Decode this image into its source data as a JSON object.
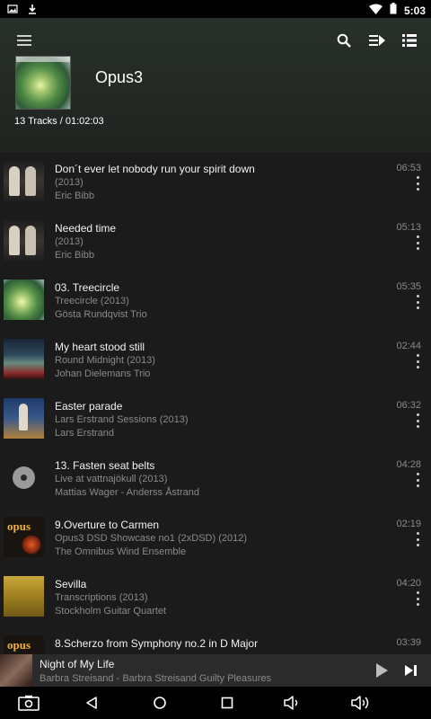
{
  "status": {
    "time": "5:03"
  },
  "header": {
    "title": "Opus3",
    "summary": "13 Tracks / 01:02:03"
  },
  "tracks": [
    {
      "title": "Don´t ever let nobody run your spirit down",
      "album": " (2013)",
      "artist": "Eric Bibb",
      "duration": "06:53",
      "art": "eric"
    },
    {
      "title": "Needed time",
      "album": " (2013)",
      "artist": "Eric Bibb",
      "duration": "05:13",
      "art": "eric"
    },
    {
      "title": "03. Treecircle",
      "album": "Treecircle (2013)",
      "artist": "Gösta Rundqvist Trio",
      "duration": "05:35",
      "art": "tree"
    },
    {
      "title": "My heart stood still",
      "album": "Round Midnight (2013)",
      "artist": "Johan Dielemans Trio",
      "duration": "02:44",
      "art": "midnight"
    },
    {
      "title": "Easter parade",
      "album": "Lars Erstrand Sessions (2013)",
      "artist": "Lars Erstrand",
      "duration": "06:32",
      "art": "easter"
    },
    {
      "title": "13. Fasten seat belts",
      "album": "Live at vattnajökull (2013)",
      "artist": "Mattias Wager - Anderss Åstrand",
      "duration": "04:28",
      "art": "disc"
    },
    {
      "title": "9.Overture to Carmen",
      "album": "Opus3 DSD Showcase no1 (2xDSD) (2012)",
      "artist": "The Omnibus Wind Ensemble",
      "duration": "02:19",
      "art": "opus"
    },
    {
      "title": "Sevilla",
      "album": "Transcriptions (2013)",
      "artist": "Stockholm Guitar Quartet",
      "duration": "04:20",
      "art": "sevilla"
    },
    {
      "title": "8.Scherzo from Symphony no.2 in D Major",
      "album": "",
      "artist": "",
      "duration": "03:39",
      "art": "opus"
    }
  ],
  "opus_logo_text": "opus",
  "now_playing": {
    "title": "Night of My Life",
    "subtitle": "Barbra Streisand - Barbra Streisand Guilty Pleasures"
  },
  "icons": {
    "status_left": [
      "image-icon",
      "download-icon"
    ],
    "status_right": [
      "wifi-icon",
      "battery-icon"
    ],
    "header": [
      "menu-icon",
      "search-icon",
      "play-queue-icon",
      "list-view-icon"
    ],
    "mini_player": [
      "play-icon",
      "skip-next-icon"
    ],
    "nav": [
      "screenshot-icon",
      "back-icon",
      "home-icon",
      "recents-icon",
      "volume-down-icon",
      "volume-up-icon"
    ]
  }
}
